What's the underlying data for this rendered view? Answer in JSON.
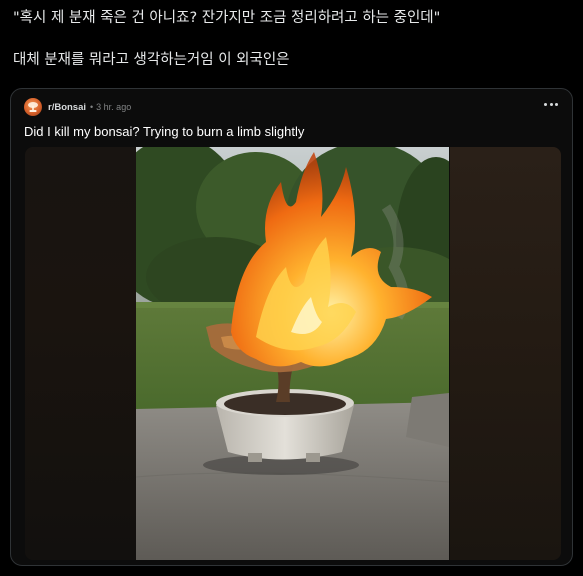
{
  "tweet": {
    "line1": "\"혹시 제 분재 죽은 건 아니죠?  잔가지만 조금 정리하려고 하는 중인데\"",
    "line2": "대체 분재를 뭐라고 생각하는거임 이 외국인은"
  },
  "post": {
    "subreddit": "r/Bonsai",
    "separator": "•",
    "age": "3 hr. ago",
    "title": "Did I kill my bonsai? Trying to burn a limb slightly"
  },
  "icons": {
    "avatar": "reddit-avatar",
    "more": "more-options-icon"
  },
  "colors": {
    "background": "#000000",
    "card_border": "#2f3336",
    "flame": "#f08a1c"
  }
}
